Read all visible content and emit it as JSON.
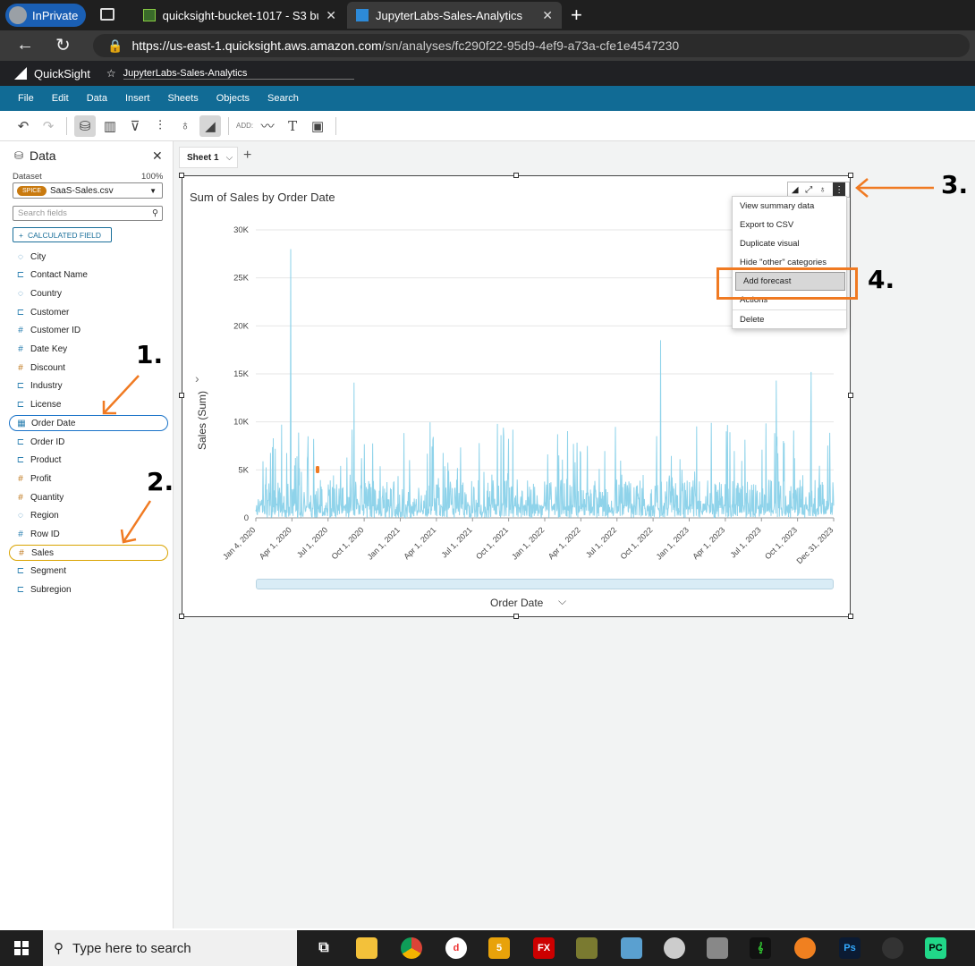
{
  "browser": {
    "inprivate": "InPrivate",
    "tabs": [
      {
        "label": "quicksight-bucket-1017 - S3 buck"
      },
      {
        "label": "JupyterLabs-Sales-Analytics"
      }
    ],
    "url_host": "https://us-east-1.quicksight.aws.amazon.com",
    "url_path": "/sn/analyses/fc290f22-95d9-4ef9-a73a-cfe1e4547230"
  },
  "app": {
    "name": "QuickSight",
    "analysis": "JupyterLabs-Sales-Analytics",
    "menu": [
      "File",
      "Edit",
      "Data",
      "Insert",
      "Sheets",
      "Objects",
      "Search"
    ],
    "add_label": "ADD:"
  },
  "data_panel": {
    "title": "Data",
    "dataset_label": "Dataset",
    "pct": "100%",
    "spice": "SPICE",
    "dataset": "SaaS-Sales.csv",
    "search_placeholder": "Search fields",
    "calc_field": "CALCULATED FIELD",
    "fields": [
      {
        "name": "City",
        "kind": "geo"
      },
      {
        "name": "Contact Name",
        "kind": "dim"
      },
      {
        "name": "Country",
        "kind": "geo"
      },
      {
        "name": "Customer",
        "kind": "dim"
      },
      {
        "name": "Customer ID",
        "kind": "num"
      },
      {
        "name": "Date Key",
        "kind": "num"
      },
      {
        "name": "Discount",
        "kind": "measure"
      },
      {
        "name": "Industry",
        "kind": "dim"
      },
      {
        "name": "License",
        "kind": "dim"
      },
      {
        "name": "Order Date",
        "kind": "date"
      },
      {
        "name": "Order ID",
        "kind": "dim"
      },
      {
        "name": "Product",
        "kind": "dim"
      },
      {
        "name": "Profit",
        "kind": "measure"
      },
      {
        "name": "Quantity",
        "kind": "measure"
      },
      {
        "name": "Region",
        "kind": "geo"
      },
      {
        "name": "Row ID",
        "kind": "num"
      },
      {
        "name": "Sales",
        "kind": "measure"
      },
      {
        "name": "Segment",
        "kind": "dim"
      },
      {
        "name": "Subregion",
        "kind": "dim"
      }
    ]
  },
  "sheet": {
    "tab": "Sheet 1"
  },
  "visual": {
    "menu_items": [
      "View summary data",
      "Export to CSV",
      "Duplicate visual",
      "Hide \"other\" categories",
      "Add forecast",
      "Actions",
      "Delete"
    ]
  },
  "annotations": [
    "1.",
    "2.",
    "3.",
    "4."
  ],
  "chart_data": {
    "type": "line",
    "title": "Sum of Sales by Order Date",
    "xlabel": "Order Date",
    "ylabel": "Sales (Sum)",
    "ylim": [
      0,
      30000
    ],
    "yticks": [
      "0",
      "5K",
      "10K",
      "15K",
      "20K",
      "25K",
      "30K"
    ],
    "xticks": [
      "Jan 4, 2020",
      "Apr 1, 2020",
      "Jul 1, 2020",
      "Oct 1, 2020",
      "Jan 1, 2021",
      "Apr 1, 2021",
      "Jul 1, 2021",
      "Oct 1, 2021",
      "Jan 1, 2022",
      "Apr 1, 2022",
      "Jul 1, 2022",
      "Oct 1, 2022",
      "Jan 1, 2023",
      "Apr 1, 2023",
      "Jul 1, 2023",
      "Oct 1, 2023",
      "Dec 31, 2023"
    ],
    "color": "#8fd3ea",
    "peaks": [
      {
        "x": "Mar 2020",
        "y": 28000
      },
      {
        "x": "Oct 2022",
        "y": 18500
      },
      {
        "x": "Nov 2023",
        "y": 15200
      },
      {
        "x": "Dec 2020",
        "y": 14100
      },
      {
        "x": "Jun 2023",
        "y": 14300
      }
    ]
  },
  "taskbar": {
    "search": "Type here to search"
  }
}
